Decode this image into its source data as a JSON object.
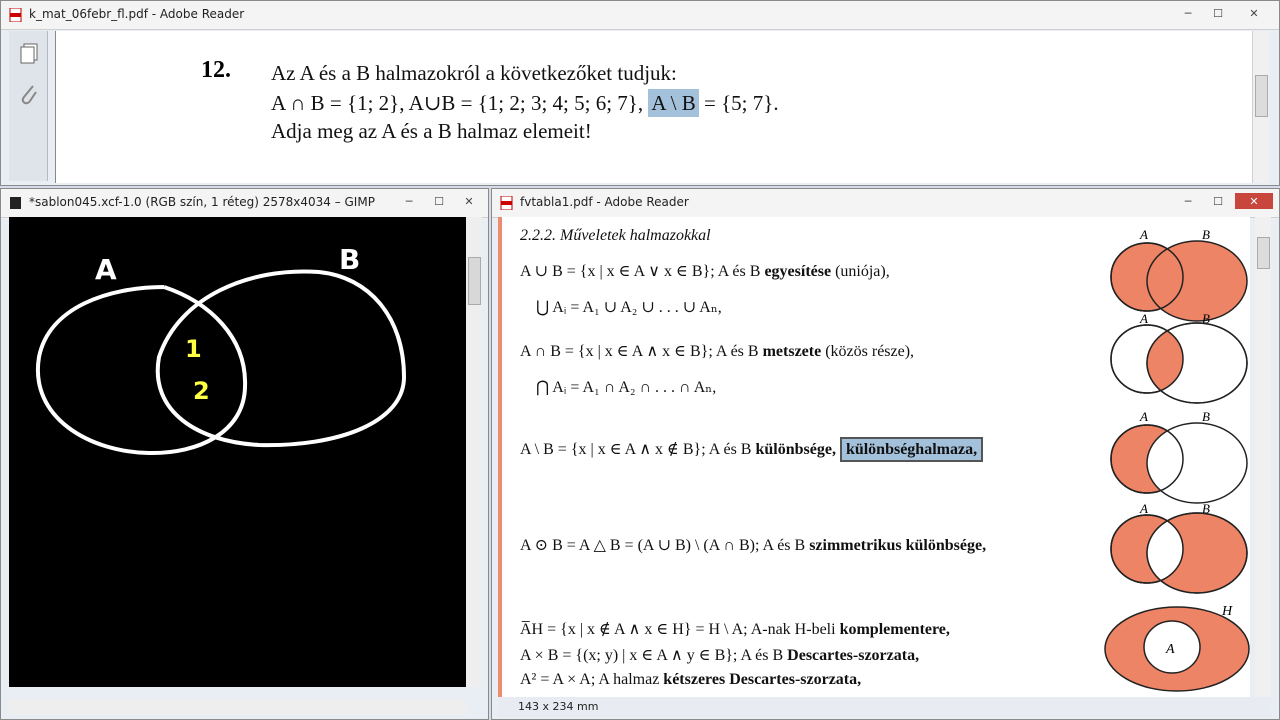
{
  "top_window": {
    "title": "k_mat_06febr_fl.pdf - Adobe Reader",
    "problem_number": "12.",
    "line1": "Az A és a B halmazokról a következőket tudjuk:",
    "line2_a": "A ∩ B = {1; 2},   A∪B = {1; 2; 3; 4; 5; 6; 7},",
    "line2_hl": "A \\ B",
    "line2_b": " = {5; 7}.",
    "line3": "Adja meg az A és a B halmaz elemeit!"
  },
  "gimp_window": {
    "title": "*sablon045.xcf-1.0 (RGB szín, 1 réteg) 2578x4034 – GIMP",
    "label_a": "A",
    "label_b": "B",
    "el1": "1",
    "el2": "2"
  },
  "reader_window": {
    "title": "fvtabla1.pdf - Adobe Reader",
    "heading": "2.2.2. Műveletek halmazokkal",
    "union_def": "A ∪ B = {x | x ∈ A ∨ x ∈ B}; A és B ",
    "union_bold": "egyesítése",
    "union_tail": " (uniója),",
    "bigunion": "⋃ Aᵢ = A₁ ∪ A₂ ∪ . . . ∪ Aₙ,",
    "inter_def": "A ∩ B = {x | x ∈ A ∧ x ∈ B}; A és B ",
    "inter_bold": "metszete",
    "inter_tail": " (közös része),",
    "biginter": "⋂ Aᵢ = A₁ ∩ A₂ ∩ . . . ∩ Aₙ,",
    "diff_def": "A \\ B = {x | x ∈ A ∧ x ∉ B}; A és B ",
    "diff_bold": "különbsége,",
    "diff_hl": "különbséghalmaza,",
    "sym_def": "A ⊙ B = A △ B = (A ∪ B) \\ (A ∩ B); A és B ",
    "sym_bold": "szimmetrikus különbsége,",
    "comp_def": "A̅H = {x | x ∉ A ∧ x ∈ H} = H \\ A; A-nak H-beli ",
    "comp_bold": "komplementere,",
    "cart_def": "A × B = {(x; y) | x ∈ A ∧ y ∈ B}; A és B ",
    "cart_bold": "Descartes-szorzata,",
    "sq_def": "A² = A × A; A halmaz ",
    "sq_bold": "kétszeres Descartes-szorzata,",
    "venn_a": "A",
    "venn_b": "B",
    "venn_h": "H",
    "status": "143 x 234 mm"
  },
  "colors": {
    "venn_fill": "#ee8466",
    "highlight": "#a3c1da",
    "canvas": "#000000"
  }
}
